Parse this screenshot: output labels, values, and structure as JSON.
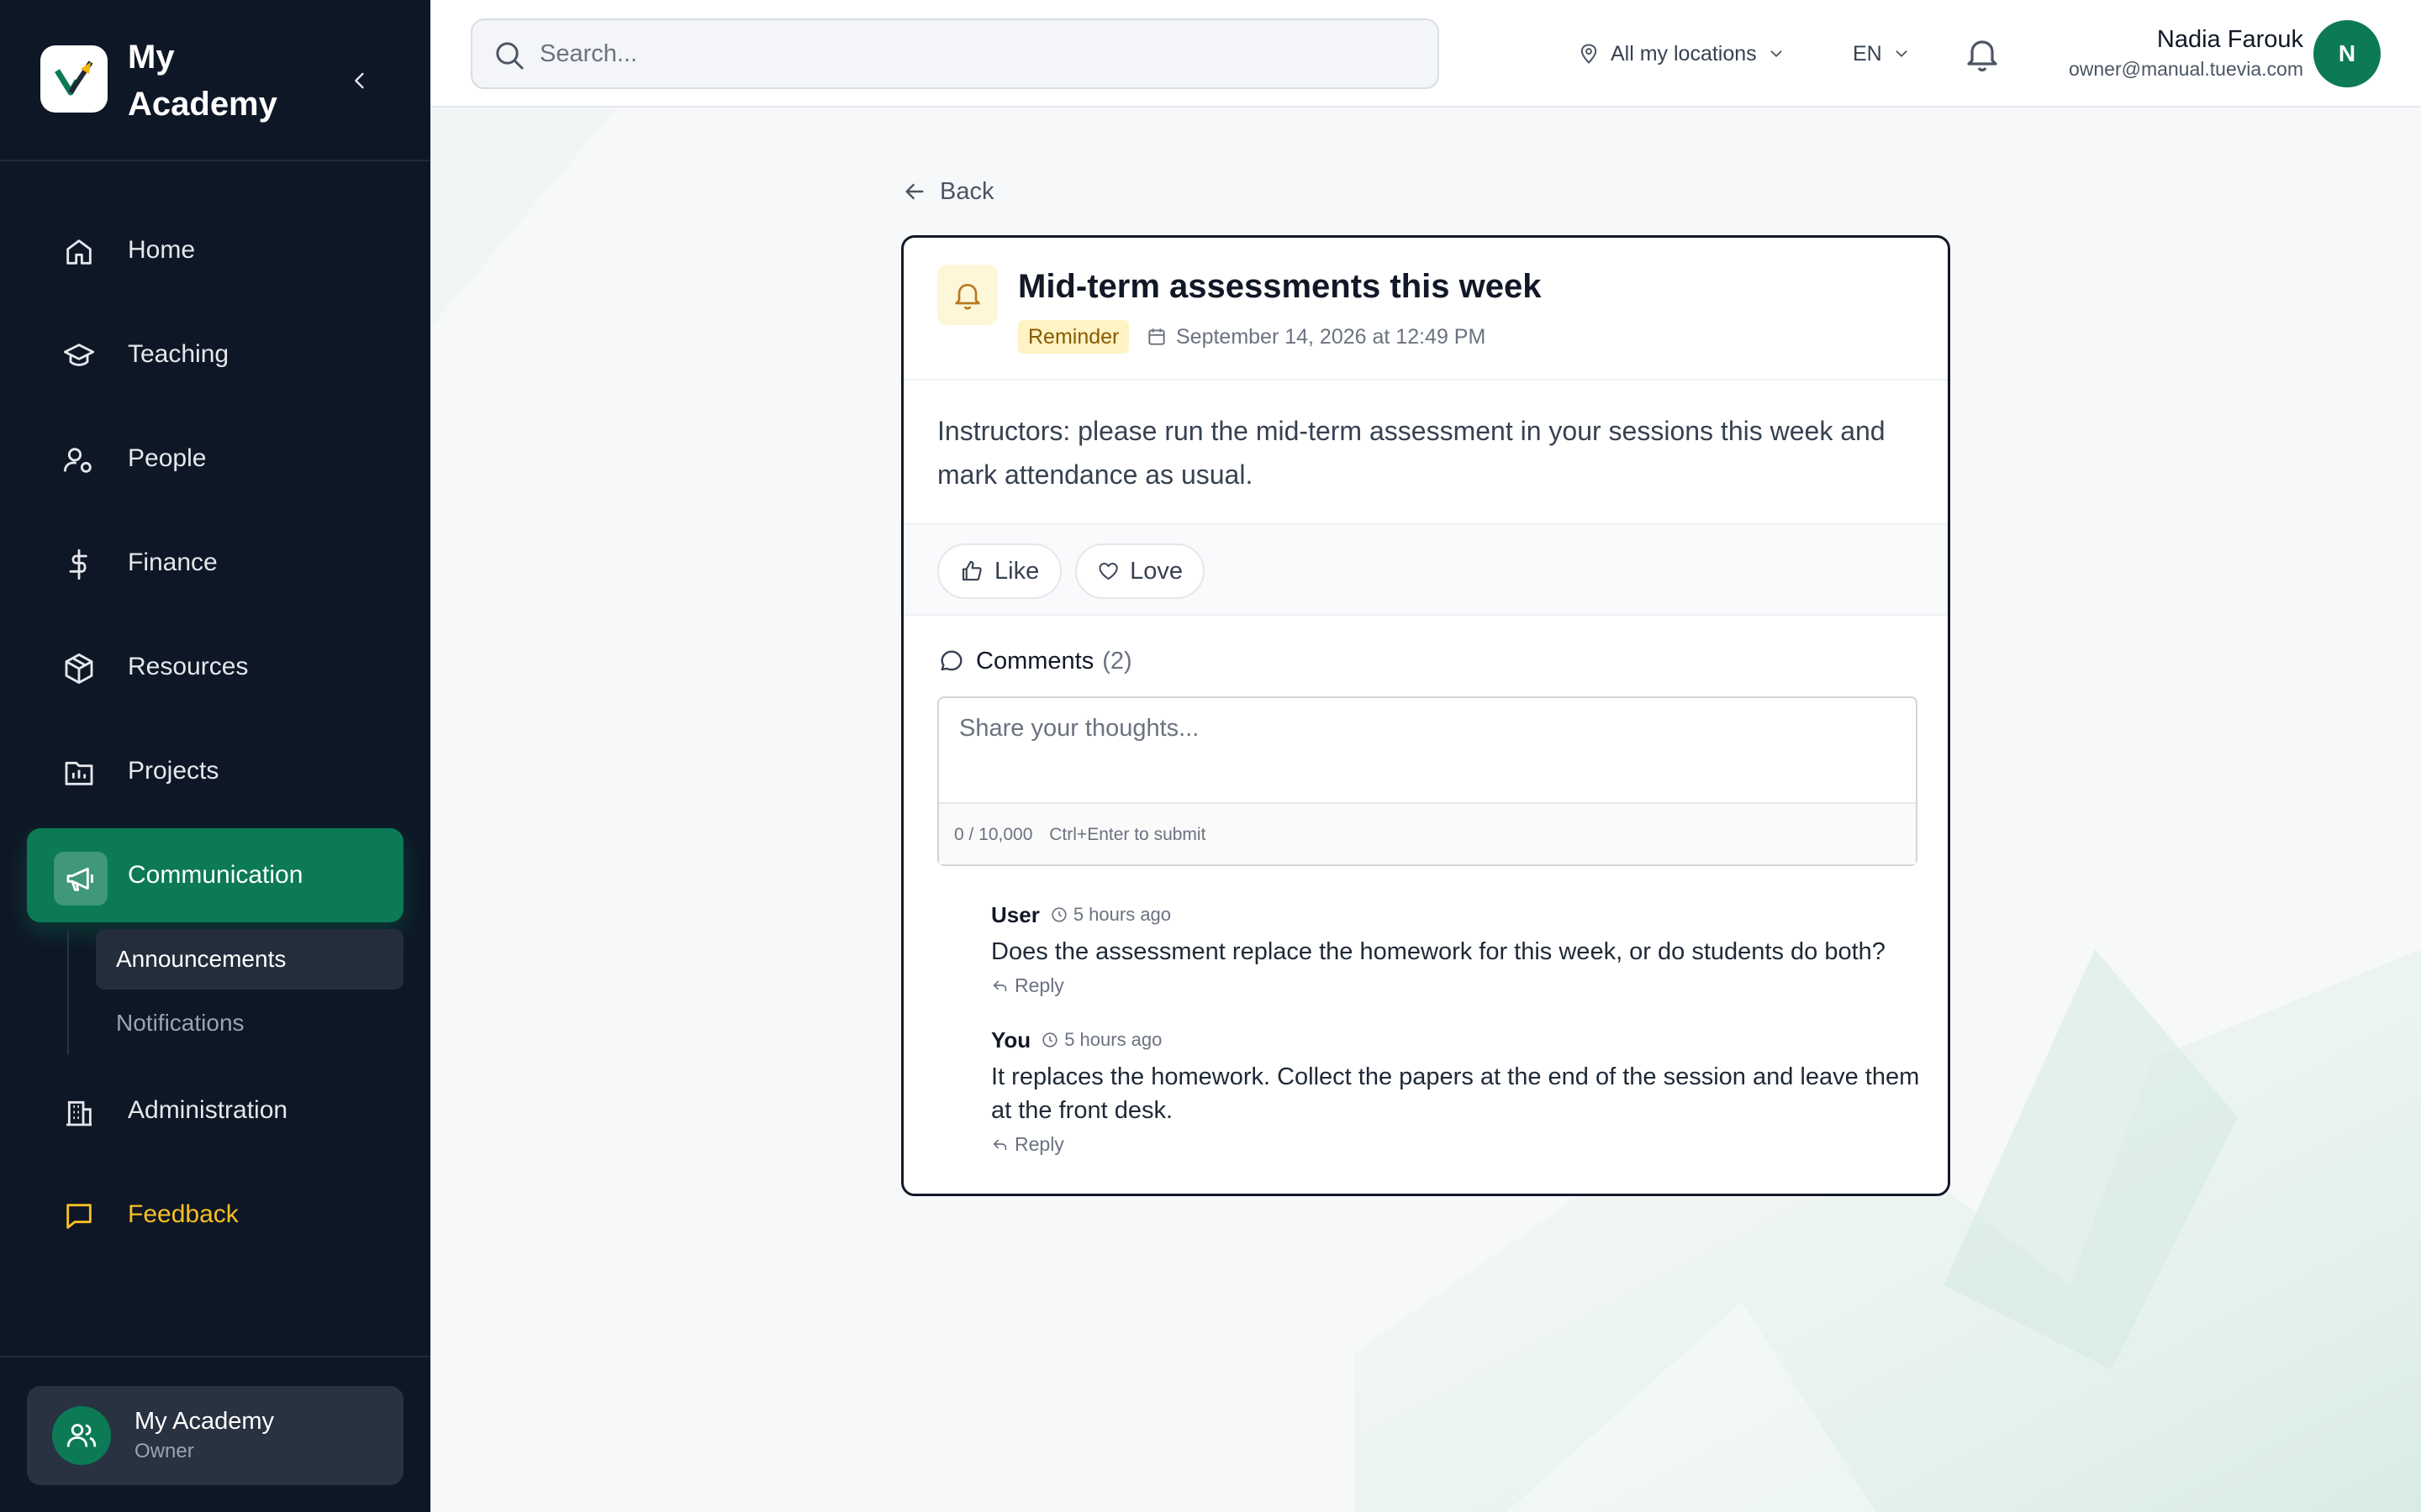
{
  "app": {
    "brand_name": "My Academy",
    "colors": {
      "sidebar_bg": "#0e1726",
      "accent": "#0b7a55",
      "feedback": "#fbbf24",
      "badge_bg": "#fdf3c4"
    }
  },
  "sidebar": {
    "items": [
      {
        "label": "Home",
        "icon": "home-icon"
      },
      {
        "label": "Teaching",
        "icon": "graduation-cap-icon"
      },
      {
        "label": "People",
        "icon": "user-gear-icon"
      },
      {
        "label": "Finance",
        "icon": "dollar-icon"
      },
      {
        "label": "Resources",
        "icon": "package-icon"
      },
      {
        "label": "Projects",
        "icon": "chart-folder-icon"
      },
      {
        "label": "Communication",
        "icon": "megaphone-icon",
        "active": true
      },
      {
        "label": "Administration",
        "icon": "building-icon"
      },
      {
        "label": "Feedback",
        "icon": "message-square-icon"
      }
    ],
    "subitems": [
      {
        "label": "Announcements",
        "active": true
      },
      {
        "label": "Notifications"
      }
    ],
    "account": {
      "name": "My Academy",
      "role": "Owner"
    }
  },
  "topbar": {
    "search_placeholder": "Search...",
    "location": "All my locations",
    "language": "EN",
    "user_name": "Nadia Farouk",
    "user_email": "owner@manual.tuevia.com",
    "avatar_initial": "N"
  },
  "page": {
    "back_label": "Back",
    "announcement": {
      "title": "Mid-term assessments this week",
      "badge": "Reminder",
      "date": "September 14, 2026 at 12:49 PM",
      "body": "Instructors: please run the mid-term assessment in your sessions this week and mark attendance as usual."
    },
    "reactions": {
      "like": "Like",
      "love": "Love"
    },
    "comments": {
      "heading": "Comments",
      "count": "(2)",
      "placeholder": "Share your thoughts...",
      "char_count": "0 / 10,000",
      "hint": "Ctrl+Enter to submit",
      "reply_label": "Reply",
      "list": [
        {
          "author": "User",
          "time": "5 hours ago",
          "text": "Does the assessment replace the homework for this week, or do students do both?"
        },
        {
          "author": "You",
          "time": "5 hours ago",
          "text": "It replaces the homework. Collect the papers at the end of the session and leave them at the front desk."
        }
      ]
    }
  }
}
